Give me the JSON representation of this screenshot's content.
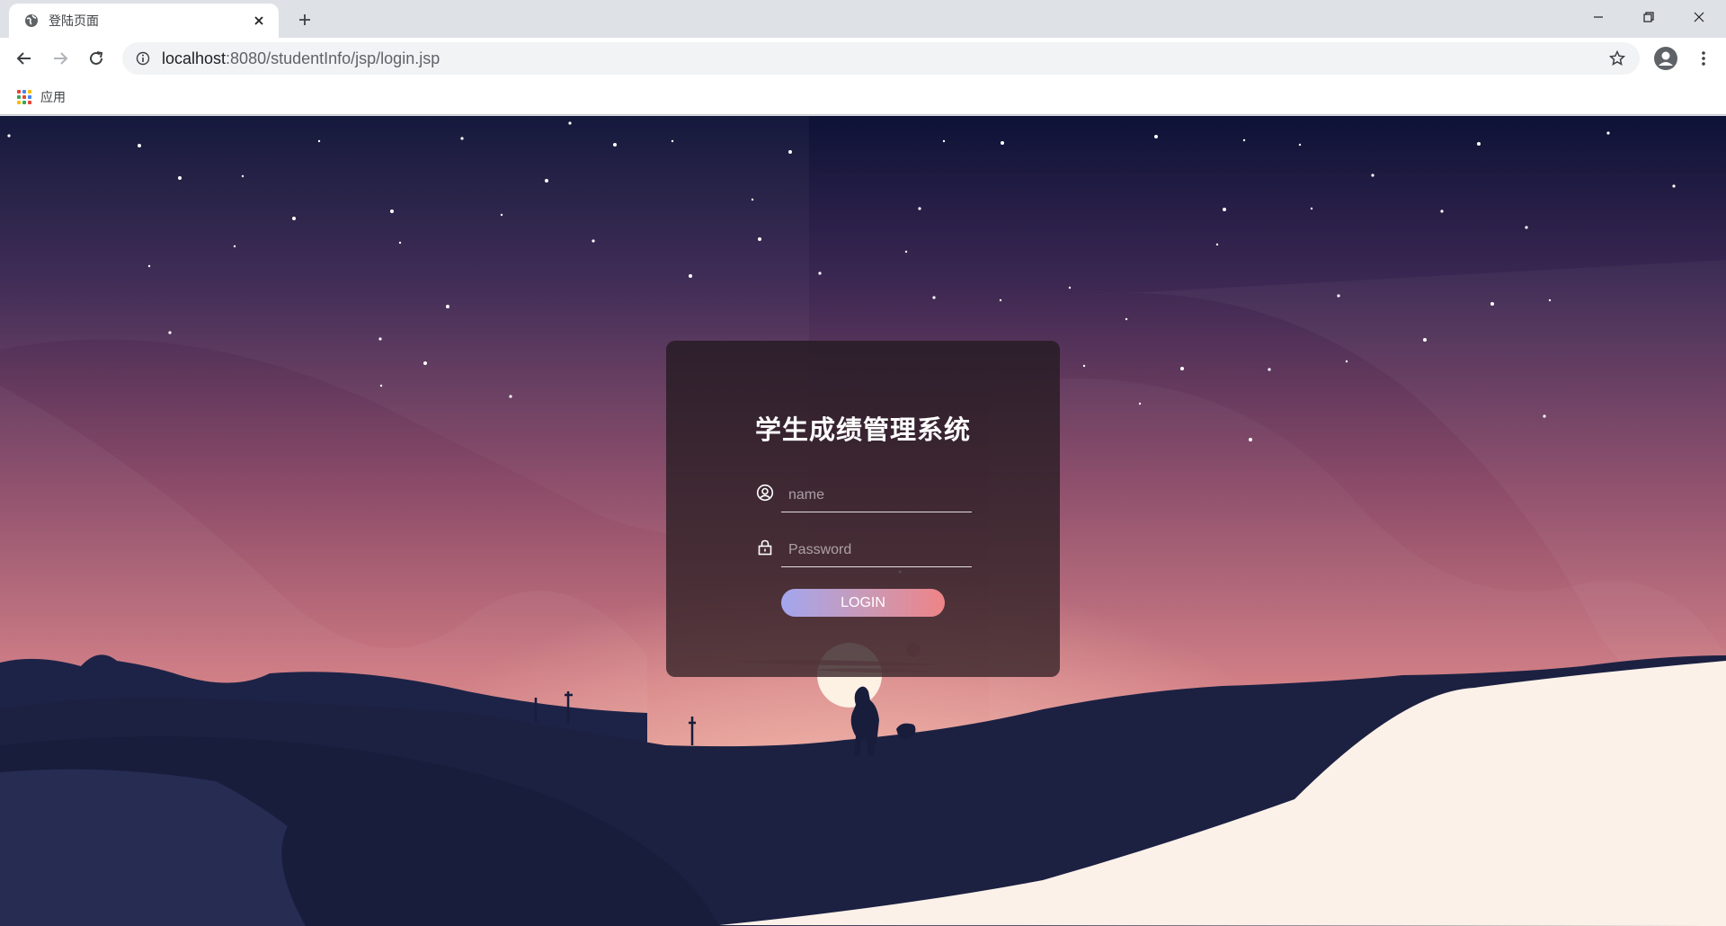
{
  "browser": {
    "tab": {
      "title": "登陆页面",
      "favicon": "globe-icon"
    },
    "url_host": "localhost",
    "url_path": ":8080/studentInfo/jsp/login.jsp",
    "bookmarks": [
      {
        "label": "应用",
        "icon": "apps-grid-icon"
      }
    ]
  },
  "login": {
    "title": "学生成绩管理系统",
    "name_placeholder": "name",
    "password_placeholder": "Password",
    "button_label": "LOGIN"
  },
  "colors": {
    "card_bg": "#2a1c26",
    "button_gradient_start": "#a3a6ef",
    "button_gradient_end": "#ee8486",
    "sky_top": "#0d1236",
    "sky_mid": "#8a4a68",
    "sky_bottom": "#f0a89c",
    "ground": "#1c2142"
  }
}
